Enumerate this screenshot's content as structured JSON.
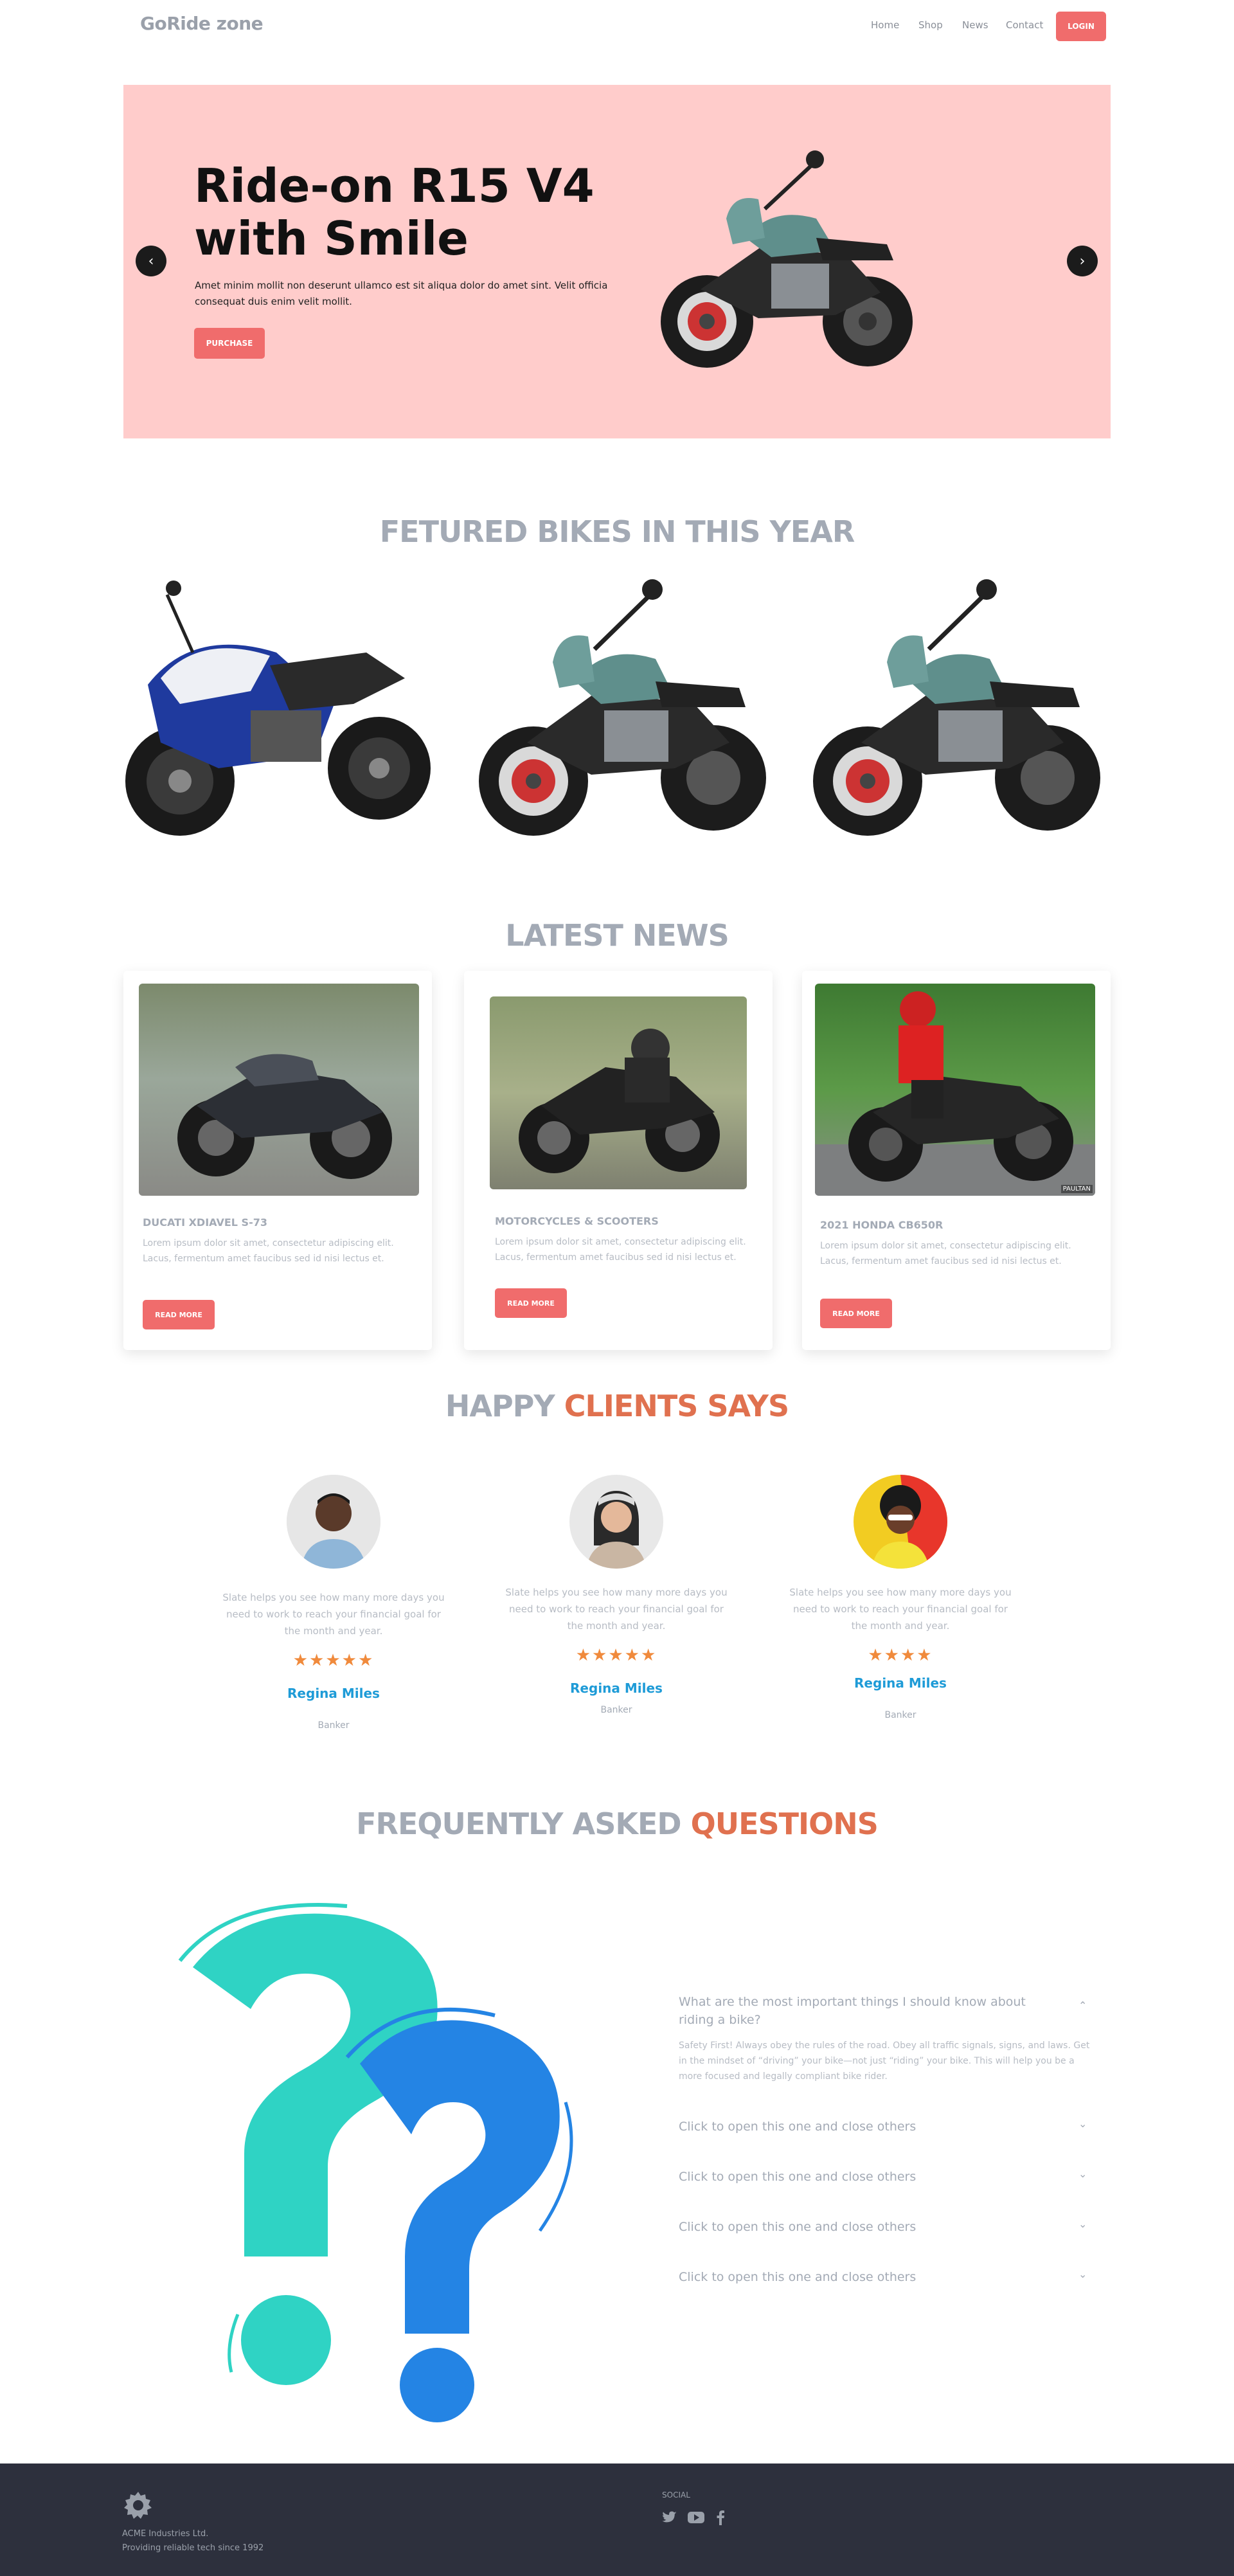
{
  "nav": {
    "logo": "GoRide zone",
    "links": [
      "Home",
      "Shop",
      "News",
      "Contact"
    ],
    "login": "LOGIN"
  },
  "hero": {
    "title": "Ride-on R15 V4 with Smile",
    "text": "Amet minim mollit non deserunt ullamco est sit aliqua dolor do amet sint. Velit officia consequat duis enim velit mollit.",
    "button": "PURCHASE",
    "prev_icon": "chevron-left-icon",
    "next_icon": "chevron-right-icon"
  },
  "featured": {
    "title": "FETURED BIKES IN THIS YEAR"
  },
  "news": {
    "title": "LATEST NEWS",
    "items": [
      {
        "title": "DUCATI XDIAVEL S-73",
        "text": "Lorem ipsum dolor sit amet, consectetur adipiscing elit. Lacus, fermentum amet faucibus sed id nisi lectus et.",
        "button": "READ MORE"
      },
      {
        "title": "MOTORCYCLES & SCOOTERS",
        "text": "Lorem ipsum dolor sit amet, consectetur adipiscing elit. Lacus, fermentum amet faucibus sed id nisi lectus et.",
        "button": "READ MORE"
      },
      {
        "title": "2021 HONDA CB650R",
        "text": "Lorem ipsum dolor sit amet, consectetur adipiscing elit. Lacus, fermentum amet faucibus sed id nisi lectus et.",
        "button": "READ MORE",
        "watermark": "PAULTAN"
      }
    ]
  },
  "testimonials": {
    "title_plain": "HAPPY",
    "title_accent": "CLIENTS SAYS",
    "items": [
      {
        "text": "Slate helps you see how many more days you need to work to reach your financial goal for the month and year.",
        "rating": 5,
        "stars": "★★★★★",
        "name": "Regina Miles",
        "role": "Banker"
      },
      {
        "text": "Slate helps you see how many more days you need to work to reach your financial goal for the month and year.",
        "rating": 5,
        "stars": "★★★★★",
        "name": "Regina Miles",
        "role": "Banker"
      },
      {
        "text": "Slate helps you see how many more days you need to work to reach your financial goal for the month and year.",
        "rating": 4,
        "stars": "★★★★",
        "name": "Regina Miles",
        "role": "Banker"
      }
    ]
  },
  "faq": {
    "title_plain": "FREQUENTLY ASKED",
    "title_accent": "QUESTIONS",
    "open_question": "What are the most important things I should know about riding a bike?",
    "open_answer": "Safety First! Always obey the rules of the road. Obey all traffic signals, signs, and laws. Get in the mindset of “driving” your bike—not just “riding” your bike. This will help you be a more focused and legally compliant bike rider.",
    "collapsed": [
      "Click to open this one and close others",
      "Click to open this one and close others",
      "Click to open this one and close others",
      "Click to open this one and close others"
    ]
  },
  "footer": {
    "company": "ACME Industries Ltd.",
    "tagline": "Providing reliable tech since 1992",
    "social_label": "SOCIAL",
    "social_icons": [
      "twitter-icon",
      "youtube-icon",
      "facebook-icon"
    ]
  },
  "colors": {
    "accent": "#f06c6c",
    "heading_accent": "#e0714f",
    "hero_bg": "#ffcccb",
    "footer_bg": "#2d303d",
    "link_blue": "#1e9bd7"
  }
}
